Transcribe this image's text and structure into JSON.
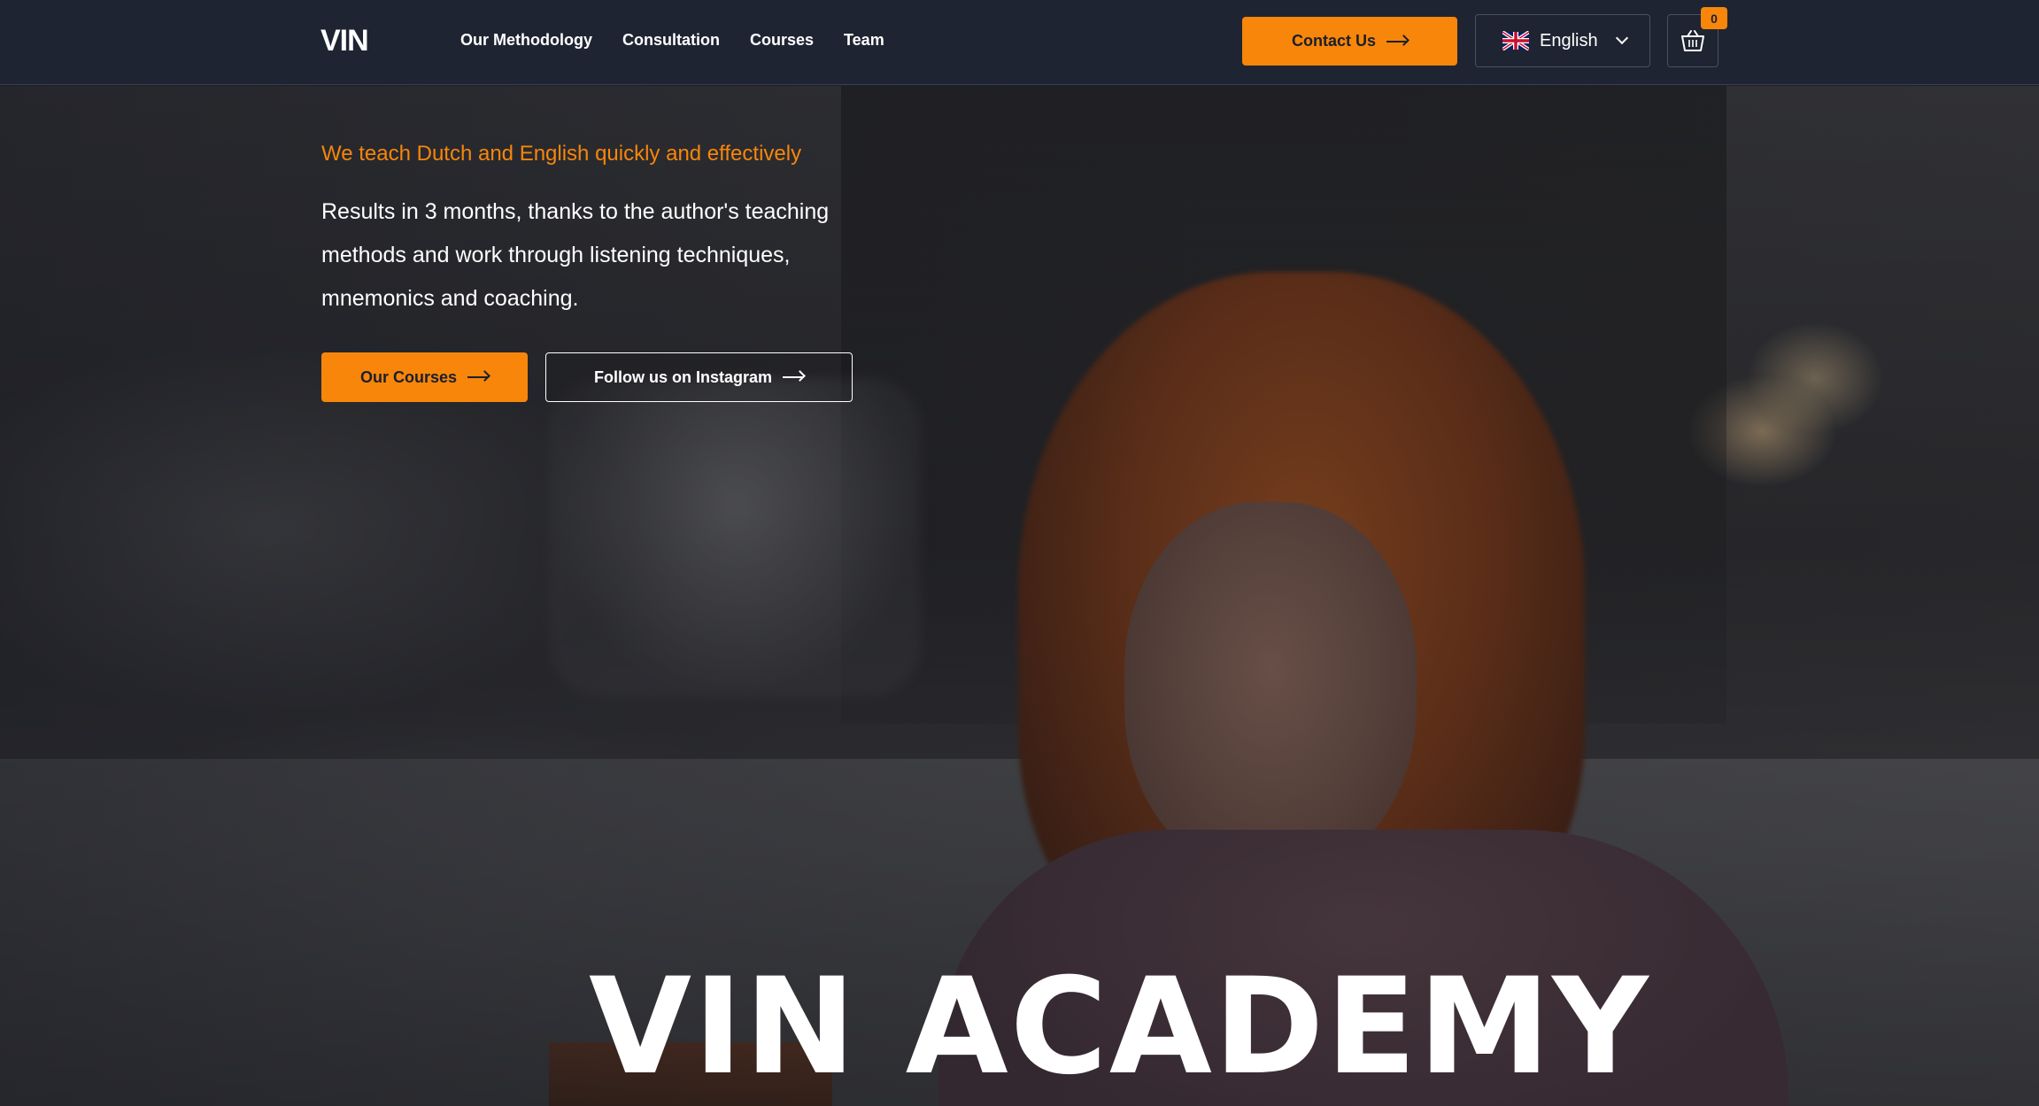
{
  "header": {
    "logo_text": "VIN",
    "nav": [
      {
        "label": "Our Methodology"
      },
      {
        "label": "Consultation"
      },
      {
        "label": "Courses"
      },
      {
        "label": "Team"
      }
    ],
    "contact_label": "Contact Us",
    "language": {
      "selected": "English",
      "flag_icon": "uk-flag-icon"
    },
    "cart": {
      "count": "0",
      "icon": "basket-icon"
    }
  },
  "hero": {
    "tagline": "We teach Dutch and English quickly and effectively",
    "lead": "Results in 3 months, thanks to the author's teaching methods and work through listening techniques, mnemonics and coaching.",
    "primary_cta": "Our Courses",
    "secondary_cta": "Follow us on Instagram",
    "title": "VIN ACADEMY"
  },
  "colors": {
    "accent": "#f7860b",
    "header_bg": "#1f2432",
    "text": "#ffffff"
  }
}
